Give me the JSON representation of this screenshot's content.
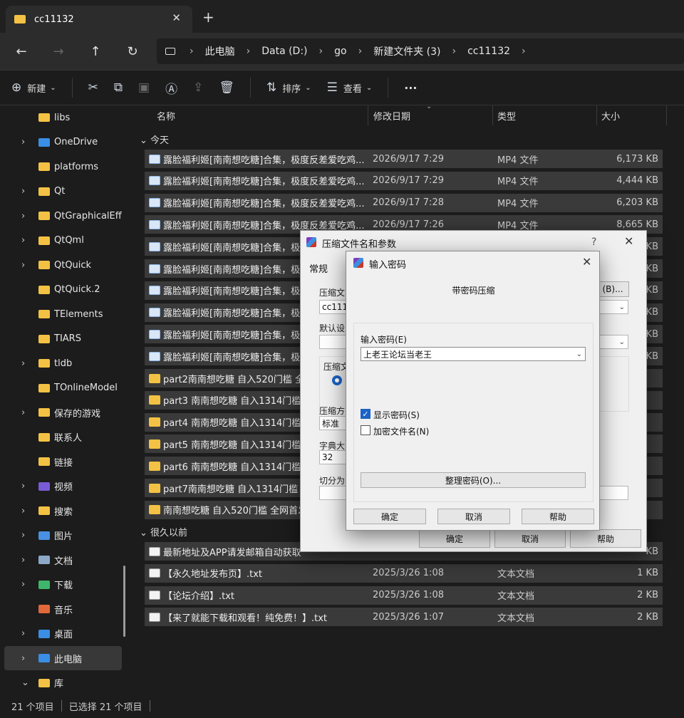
{
  "tab": {
    "title": "cc11132",
    "close": "✕",
    "add": "+"
  },
  "nav": {
    "back": "←",
    "forward": "→",
    "up": "↑",
    "refresh": "↻"
  },
  "breadcrumb": [
    "此电脑",
    "Data (D:)",
    "go",
    "新建文件夹 (3)",
    "cc11132"
  ],
  "toolbar": {
    "new_label": "新建",
    "sort_label": "排序",
    "view_label": "查看",
    "more": "···"
  },
  "sidebar": [
    {
      "label": "libs",
      "chevron": "",
      "icon": "folder"
    },
    {
      "label": "OneDrive",
      "chevron": "›",
      "icon": "cloud"
    },
    {
      "label": "platforms",
      "chevron": "",
      "icon": "folder"
    },
    {
      "label": "Qt",
      "chevron": "›",
      "icon": "folder"
    },
    {
      "label": "QtGraphicalEff",
      "chevron": "›",
      "icon": "folder"
    },
    {
      "label": "QtQml",
      "chevron": "›",
      "icon": "folder"
    },
    {
      "label": "QtQuick",
      "chevron": "›",
      "icon": "folder"
    },
    {
      "label": "QtQuick.2",
      "chevron": "",
      "icon": "folder"
    },
    {
      "label": "TElements",
      "chevron": "",
      "icon": "folder"
    },
    {
      "label": "TIARS",
      "chevron": "",
      "icon": "folder"
    },
    {
      "label": "tldb",
      "chevron": "›",
      "icon": "folder"
    },
    {
      "label": "TOnlineModel",
      "chevron": "",
      "icon": "folder"
    },
    {
      "label": "保存的游戏",
      "chevron": "›",
      "icon": "folder"
    },
    {
      "label": "联系人",
      "chevron": "",
      "icon": "folder"
    },
    {
      "label": "链接",
      "chevron": "",
      "icon": "folder"
    },
    {
      "label": "视频",
      "chevron": "›",
      "icon": "video"
    },
    {
      "label": "搜索",
      "chevron": "›",
      "icon": "folder"
    },
    {
      "label": "图片",
      "chevron": "›",
      "icon": "picture"
    },
    {
      "label": "文档",
      "chevron": "›",
      "icon": "document"
    },
    {
      "label": "下载",
      "chevron": "›",
      "icon": "download"
    },
    {
      "label": "音乐",
      "chevron": "",
      "icon": "music"
    },
    {
      "label": "桌面",
      "chevron": "›",
      "icon": "desktop"
    },
    {
      "label": "此电脑",
      "chevron": "›",
      "icon": "pc"
    },
    {
      "label": "库",
      "chevron": "⌄",
      "icon": "folder"
    }
  ],
  "columns": {
    "name": "名称",
    "date": "修改日期",
    "type": "类型",
    "size": "大小"
  },
  "groups": {
    "today": "今天",
    "long_ago": "很久以前"
  },
  "files_today": [
    {
      "name": "露脸福利姬[南南想吃糖]合集，极度反差爱吃鸡...",
      "date": "2026/9/17 7:29",
      "type": "MP4 文件",
      "size": "6,173 KB",
      "icon": "video"
    },
    {
      "name": "露脸福利姬[南南想吃糖]合集，极度反差爱吃鸡...",
      "date": "2026/9/17 7:29",
      "type": "MP4 文件",
      "size": "4,444 KB",
      "icon": "video"
    },
    {
      "name": "露脸福利姬[南南想吃糖]合集，极度反差爱吃鸡...",
      "date": "2026/9/17 7:28",
      "type": "MP4 文件",
      "size": "6,203 KB",
      "icon": "video"
    },
    {
      "name": "露脸福利姬[南南想吃糖]合集，极度反差爱吃鸡...",
      "date": "2026/9/17 7:26",
      "type": "MP4 文件",
      "size": "8,665 KB",
      "icon": "video"
    },
    {
      "name": "露脸福利姬[南南想吃糖]合集，极",
      "date": "",
      "type": "",
      "size": "KB",
      "icon": "video"
    },
    {
      "name": "露脸福利姬[南南想吃糖]合集，极",
      "date": "",
      "type": "",
      "size": "KB",
      "icon": "video"
    },
    {
      "name": "露脸福利姬[南南想吃糖]合集，极",
      "date": "",
      "type": "",
      "size": "KB",
      "icon": "video"
    },
    {
      "name": "露脸福利姬[南南想吃糖]合集，极",
      "date": "",
      "type": "",
      "size": "KB",
      "icon": "video"
    },
    {
      "name": "露脸福利姬[南南想吃糖]合集，极",
      "date": "",
      "type": "",
      "size": "KB",
      "icon": "video"
    },
    {
      "name": "露脸福利姬[南南想吃糖]合集，极",
      "date": "",
      "type": "",
      "size": "KB",
      "icon": "video"
    },
    {
      "name": "part2南南想吃糖 自入520门槛 全",
      "date": "",
      "type": "",
      "size": "",
      "icon": "folder"
    },
    {
      "name": "part3 南南想吃糖 自入1314门槛",
      "date": "",
      "type": "",
      "size": "",
      "icon": "folder"
    },
    {
      "name": "part4 南南想吃糖 自入1314门槛",
      "date": "",
      "type": "",
      "size": "",
      "icon": "folder"
    },
    {
      "name": "part5 南南想吃糖 自入1314门槛",
      "date": "",
      "type": "",
      "size": "",
      "icon": "folder"
    },
    {
      "name": "part6 南南想吃糖 自入1314门槛",
      "date": "",
      "type": "",
      "size": "",
      "icon": "folder"
    },
    {
      "name": "part7南南想吃糖 自入1314门槛",
      "date": "",
      "type": "",
      "size": "",
      "icon": "folder"
    },
    {
      "name": "南南想吃糖 自入520门槛 全网首发",
      "date": "",
      "type": "",
      "size": "",
      "icon": "folder"
    }
  ],
  "files_old": [
    {
      "name": "最新地址及APP请发邮箱自动获取",
      "date": "",
      "type": "",
      "size": "KB",
      "icon": "txt"
    },
    {
      "name": "【永久地址发布页】.txt",
      "date": "2025/3/26 1:08",
      "type": "文本文档",
      "size": "1 KB",
      "icon": "txt"
    },
    {
      "name": "【论坛介绍】.txt",
      "date": "2025/3/26 1:08",
      "type": "文本文档",
      "size": "2 KB",
      "icon": "txt"
    },
    {
      "name": "【来了就能下载和观看！纯免费！】.txt",
      "date": "2025/3/26 1:07",
      "type": "文本文档",
      "size": "2 KB",
      "icon": "txt"
    }
  ],
  "status": {
    "count": "21 个项目",
    "selected": "已选择 21 个项目"
  },
  "dialog_archive": {
    "title": "压缩文件名和参数",
    "help": "?",
    "close": "✕",
    "tab_general": "常规",
    "label_filename": "压缩文",
    "filename_value": "cc1113",
    "browse": "(B)...",
    "label_default": "默认设",
    "label_format": "压缩文",
    "label_method": "压缩方",
    "method_value": "标准",
    "label_dict": "字典大",
    "dict_value": "32",
    "label_split": "切分为",
    "ok": "确定",
    "cancel": "取消",
    "helpbtn": "帮助"
  },
  "dialog_password": {
    "title": "输入密码",
    "close": "✕",
    "heading": "带密码压缩",
    "pwd_label": "输入密码(E)",
    "pwd_value": "上老王论坛当老王",
    "show_pwd": "显示密码(S)",
    "show_pwd_checked": true,
    "encrypt_names": "加密文件名(N)",
    "encrypt_names_checked": false,
    "manage": "整理密码(O)...",
    "ok": "确定",
    "cancel": "取消",
    "help": "帮助"
  }
}
